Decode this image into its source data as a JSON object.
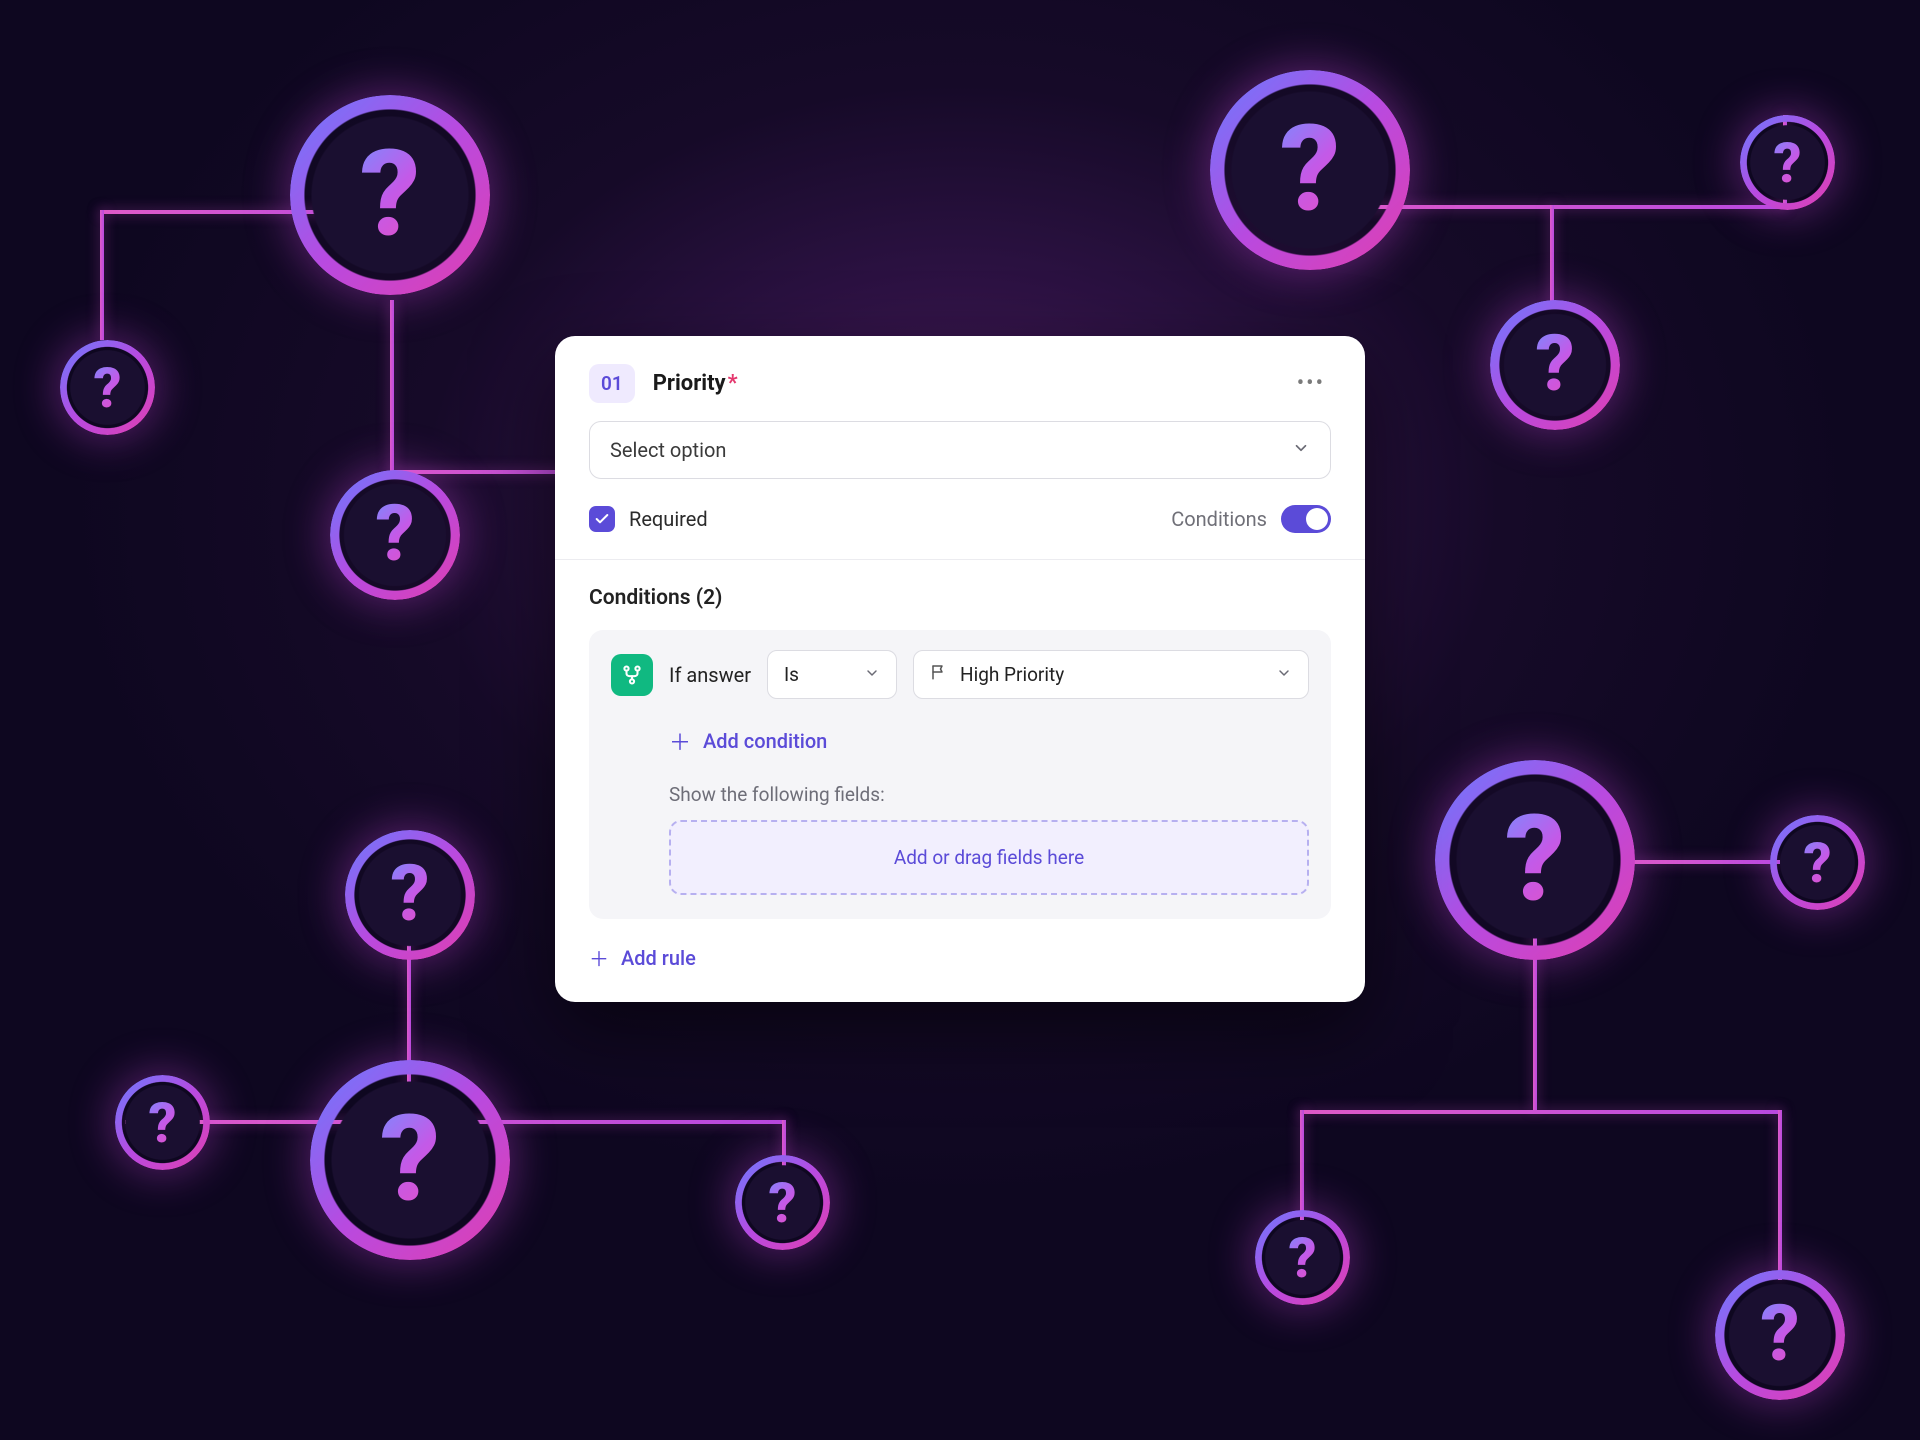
{
  "card": {
    "number": "01",
    "title": "Priority",
    "required_star": "*",
    "select_placeholder": "Select option",
    "required_label": "Required",
    "required_checked": true,
    "conditions_label": "Conditions",
    "conditions_on": true
  },
  "conditions": {
    "title": "Conditions (2)",
    "rule": {
      "if_label": "If answer",
      "operator": "Is",
      "value": "High Priority",
      "add_condition_label": "Add condition",
      "show_fields_label": "Show the following fields:",
      "dropzone_text": "Add or drag fields here"
    },
    "add_rule_label": "Add rule"
  },
  "decor": {
    "q": "?"
  }
}
